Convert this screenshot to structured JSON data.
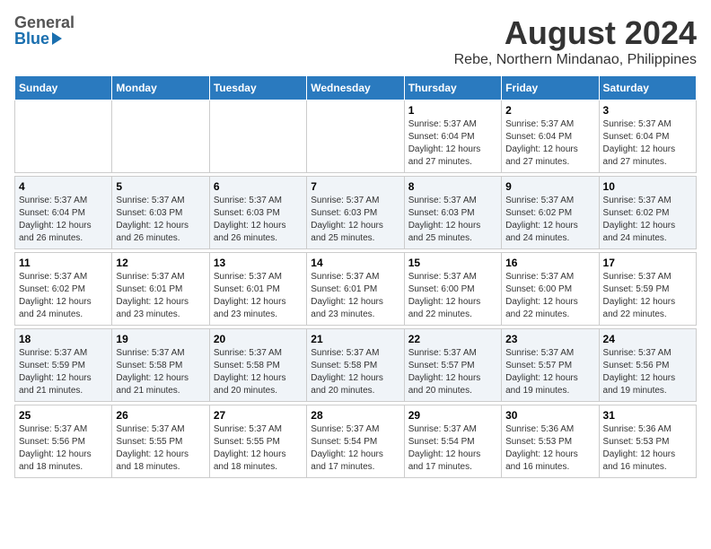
{
  "header": {
    "logo": {
      "general": "General",
      "blue": "Blue"
    },
    "title": "August 2024",
    "subtitle": "Rebe, Northern Mindanao, Philippines"
  },
  "calendar": {
    "weekdays": [
      "Sunday",
      "Monday",
      "Tuesday",
      "Wednesday",
      "Thursday",
      "Friday",
      "Saturday"
    ],
    "weeks": [
      {
        "rowClass": "row-week1",
        "days": [
          {
            "date": "",
            "info": ""
          },
          {
            "date": "",
            "info": ""
          },
          {
            "date": "",
            "info": ""
          },
          {
            "date": "",
            "info": ""
          },
          {
            "date": "1",
            "info": "Sunrise: 5:37 AM\nSunset: 6:04 PM\nDaylight: 12 hours\nand 27 minutes."
          },
          {
            "date": "2",
            "info": "Sunrise: 5:37 AM\nSunset: 6:04 PM\nDaylight: 12 hours\nand 27 minutes."
          },
          {
            "date": "3",
            "info": "Sunrise: 5:37 AM\nSunset: 6:04 PM\nDaylight: 12 hours\nand 27 minutes."
          }
        ]
      },
      {
        "rowClass": "row-week2",
        "days": [
          {
            "date": "4",
            "info": "Sunrise: 5:37 AM\nSunset: 6:04 PM\nDaylight: 12 hours\nand 26 minutes."
          },
          {
            "date": "5",
            "info": "Sunrise: 5:37 AM\nSunset: 6:03 PM\nDaylight: 12 hours\nand 26 minutes."
          },
          {
            "date": "6",
            "info": "Sunrise: 5:37 AM\nSunset: 6:03 PM\nDaylight: 12 hours\nand 26 minutes."
          },
          {
            "date": "7",
            "info": "Sunrise: 5:37 AM\nSunset: 6:03 PM\nDaylight: 12 hours\nand 25 minutes."
          },
          {
            "date": "8",
            "info": "Sunrise: 5:37 AM\nSunset: 6:03 PM\nDaylight: 12 hours\nand 25 minutes."
          },
          {
            "date": "9",
            "info": "Sunrise: 5:37 AM\nSunset: 6:02 PM\nDaylight: 12 hours\nand 24 minutes."
          },
          {
            "date": "10",
            "info": "Sunrise: 5:37 AM\nSunset: 6:02 PM\nDaylight: 12 hours\nand 24 minutes."
          }
        ]
      },
      {
        "rowClass": "row-week3",
        "days": [
          {
            "date": "11",
            "info": "Sunrise: 5:37 AM\nSunset: 6:02 PM\nDaylight: 12 hours\nand 24 minutes."
          },
          {
            "date": "12",
            "info": "Sunrise: 5:37 AM\nSunset: 6:01 PM\nDaylight: 12 hours\nand 23 minutes."
          },
          {
            "date": "13",
            "info": "Sunrise: 5:37 AM\nSunset: 6:01 PM\nDaylight: 12 hours\nand 23 minutes."
          },
          {
            "date": "14",
            "info": "Sunrise: 5:37 AM\nSunset: 6:01 PM\nDaylight: 12 hours\nand 23 minutes."
          },
          {
            "date": "15",
            "info": "Sunrise: 5:37 AM\nSunset: 6:00 PM\nDaylight: 12 hours\nand 22 minutes."
          },
          {
            "date": "16",
            "info": "Sunrise: 5:37 AM\nSunset: 6:00 PM\nDaylight: 12 hours\nand 22 minutes."
          },
          {
            "date": "17",
            "info": "Sunrise: 5:37 AM\nSunset: 5:59 PM\nDaylight: 12 hours\nand 22 minutes."
          }
        ]
      },
      {
        "rowClass": "row-week4",
        "days": [
          {
            "date": "18",
            "info": "Sunrise: 5:37 AM\nSunset: 5:59 PM\nDaylight: 12 hours\nand 21 minutes."
          },
          {
            "date": "19",
            "info": "Sunrise: 5:37 AM\nSunset: 5:58 PM\nDaylight: 12 hours\nand 21 minutes."
          },
          {
            "date": "20",
            "info": "Sunrise: 5:37 AM\nSunset: 5:58 PM\nDaylight: 12 hours\nand 20 minutes."
          },
          {
            "date": "21",
            "info": "Sunrise: 5:37 AM\nSunset: 5:58 PM\nDaylight: 12 hours\nand 20 minutes."
          },
          {
            "date": "22",
            "info": "Sunrise: 5:37 AM\nSunset: 5:57 PM\nDaylight: 12 hours\nand 20 minutes."
          },
          {
            "date": "23",
            "info": "Sunrise: 5:37 AM\nSunset: 5:57 PM\nDaylight: 12 hours\nand 19 minutes."
          },
          {
            "date": "24",
            "info": "Sunrise: 5:37 AM\nSunset: 5:56 PM\nDaylight: 12 hours\nand 19 minutes."
          }
        ]
      },
      {
        "rowClass": "row-week5",
        "days": [
          {
            "date": "25",
            "info": "Sunrise: 5:37 AM\nSunset: 5:56 PM\nDaylight: 12 hours\nand 18 minutes."
          },
          {
            "date": "26",
            "info": "Sunrise: 5:37 AM\nSunset: 5:55 PM\nDaylight: 12 hours\nand 18 minutes."
          },
          {
            "date": "27",
            "info": "Sunrise: 5:37 AM\nSunset: 5:55 PM\nDaylight: 12 hours\nand 18 minutes."
          },
          {
            "date": "28",
            "info": "Sunrise: 5:37 AM\nSunset: 5:54 PM\nDaylight: 12 hours\nand 17 minutes."
          },
          {
            "date": "29",
            "info": "Sunrise: 5:37 AM\nSunset: 5:54 PM\nDaylight: 12 hours\nand 17 minutes."
          },
          {
            "date": "30",
            "info": "Sunrise: 5:36 AM\nSunset: 5:53 PM\nDaylight: 12 hours\nand 16 minutes."
          },
          {
            "date": "31",
            "info": "Sunrise: 5:36 AM\nSunset: 5:53 PM\nDaylight: 12 hours\nand 16 minutes."
          }
        ]
      }
    ]
  }
}
